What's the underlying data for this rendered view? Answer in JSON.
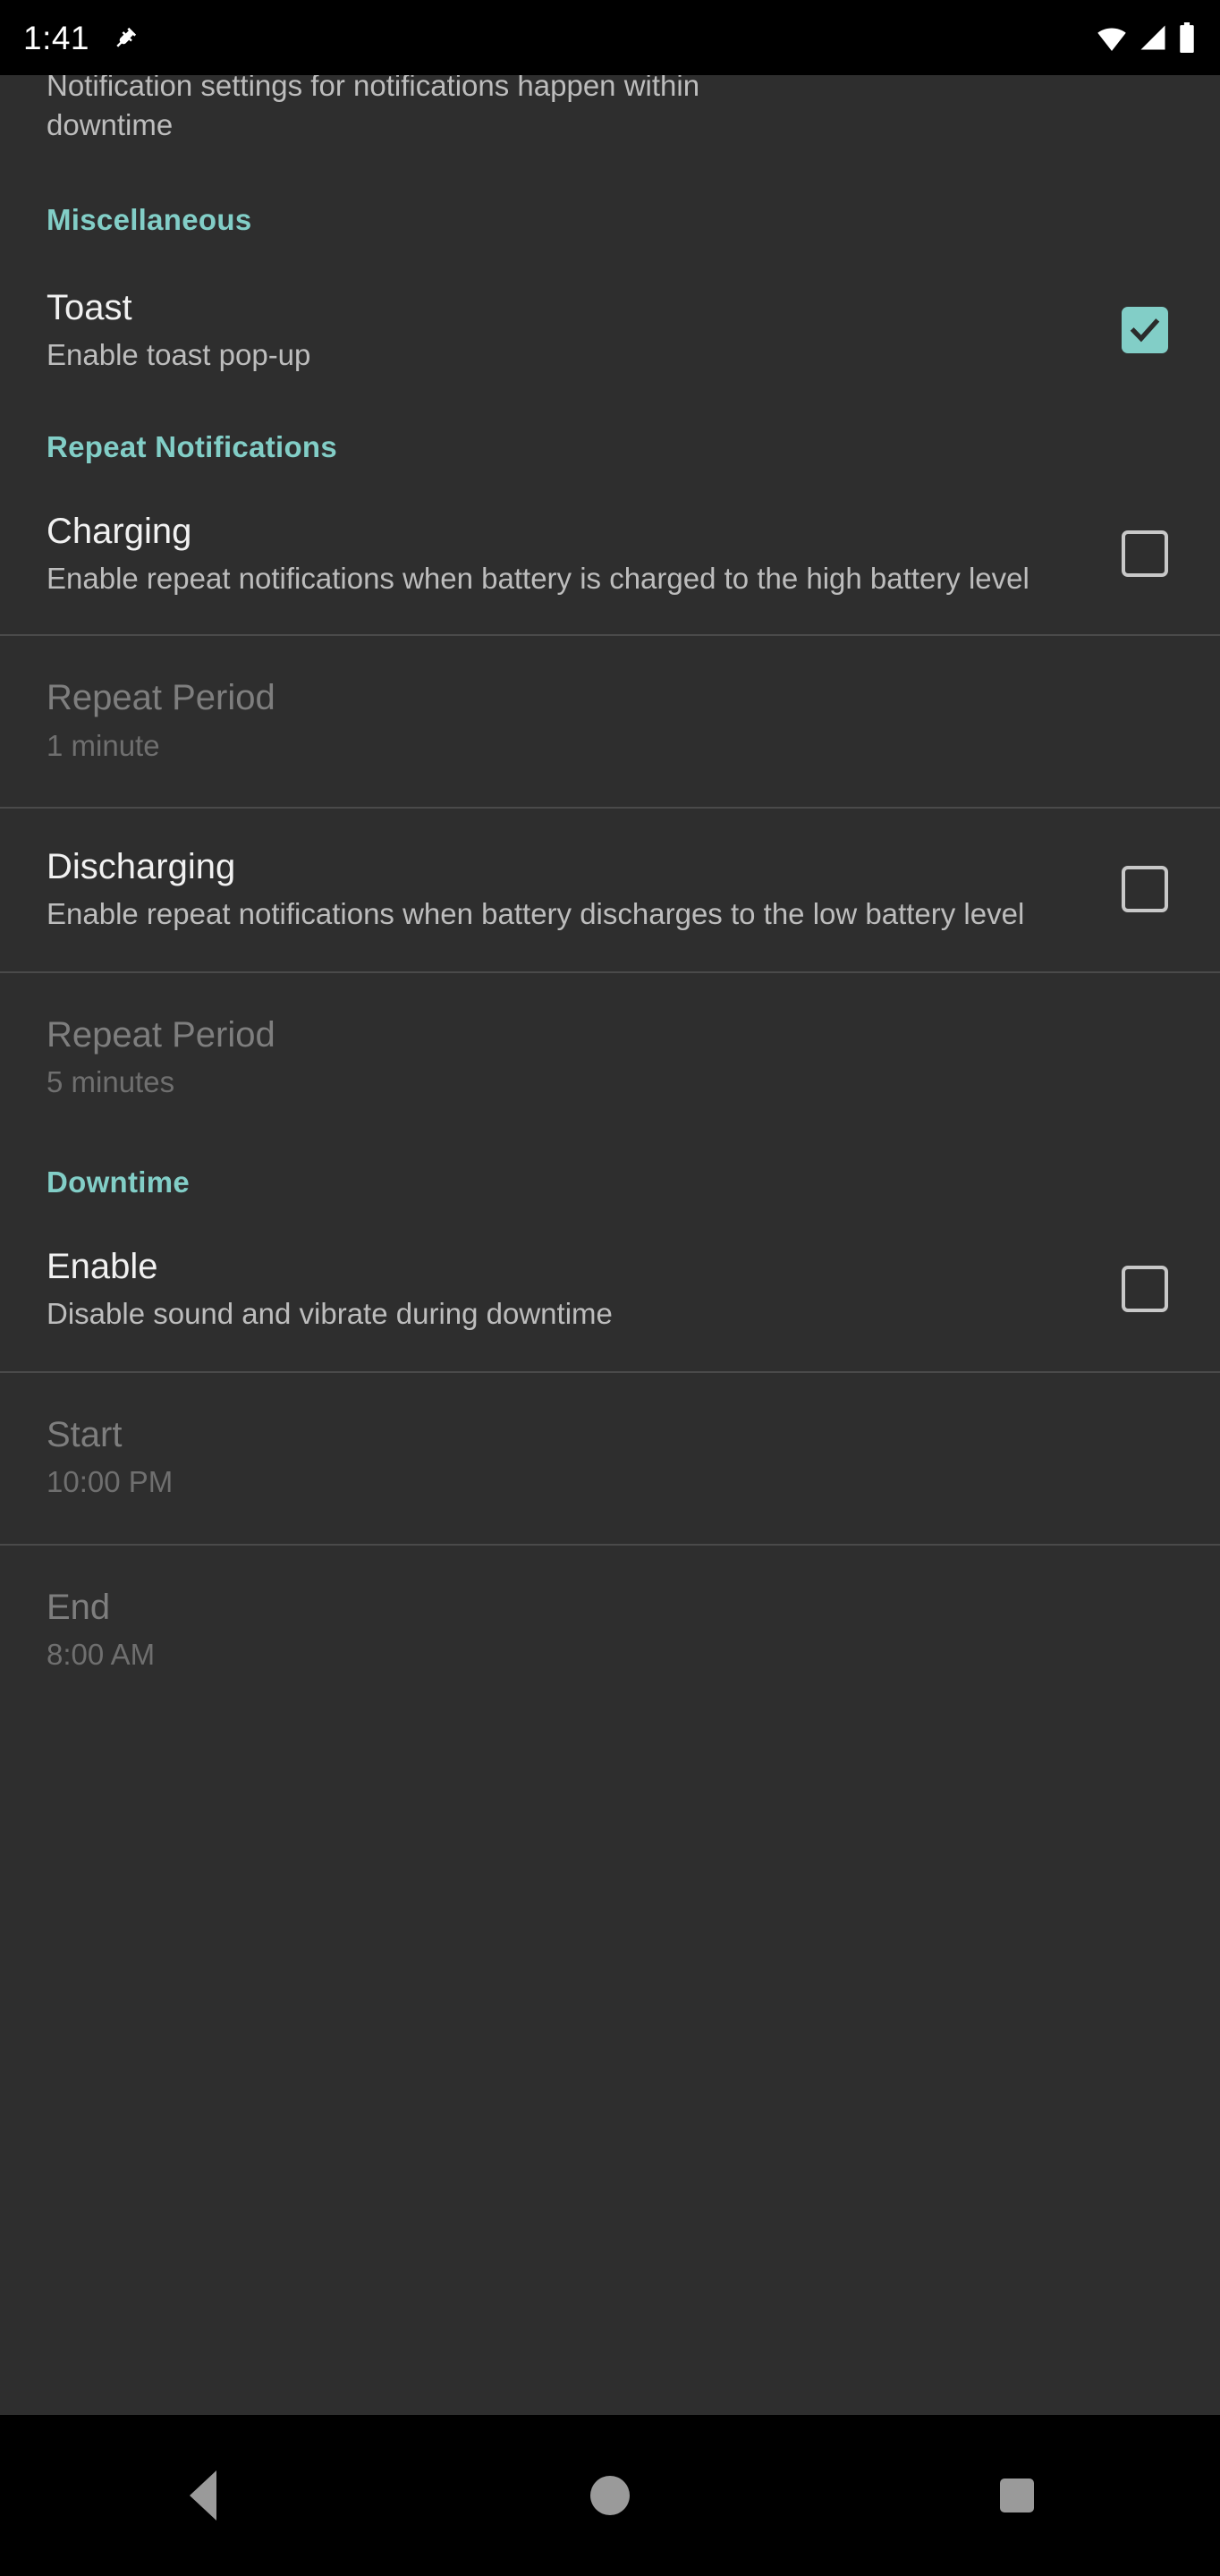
{
  "status_bar": {
    "clock": "1:41",
    "icons": [
      "plug-icon",
      "wifi-icon",
      "cellular-signal-icon",
      "battery-icon"
    ]
  },
  "colors": {
    "background": "#2e2e2e",
    "accent_teal": "#82cec7",
    "title_text": "#f1f1f1",
    "summary_text": "#bdbdbd",
    "disabled_text": "#7e7e7e",
    "divider": "#4a4a4a",
    "status_bar_bg": "#000000"
  },
  "clipped_item": {
    "summary_line1": "Notification settings for notifications happen within",
    "summary_line2": "downtime"
  },
  "sections": [
    {
      "header": "Miscellaneous",
      "items": [
        {
          "title": "Toast",
          "summary": "Enable toast pop-up",
          "checkbox": "checked",
          "enabled": true
        }
      ]
    },
    {
      "header": "Repeat Notifications",
      "items": [
        {
          "title": "Charging",
          "summary": "Enable repeat notifications when battery is charged to the high battery level",
          "checkbox": "unchecked",
          "enabled": true
        },
        {
          "title": "Repeat Period",
          "summary": "1 minute",
          "checkbox": "none",
          "enabled": false
        },
        {
          "title": "Discharging",
          "summary": "Enable repeat notifications when battery discharges to the low battery level",
          "checkbox": "unchecked",
          "enabled": true
        },
        {
          "title": "Repeat Period",
          "summary": "5 minutes",
          "checkbox": "none",
          "enabled": false
        }
      ]
    },
    {
      "header": "Downtime",
      "items": [
        {
          "title": "Enable",
          "summary": "Disable sound and vibrate during downtime",
          "checkbox": "unchecked",
          "enabled": true
        },
        {
          "title": "Start",
          "summary": "10:00 PM",
          "checkbox": "none",
          "enabled": false
        },
        {
          "title": "End",
          "summary": "8:00 AM",
          "checkbox": "none",
          "enabled": false
        }
      ]
    }
  ],
  "nav_bar": {
    "back": "back-icon",
    "home": "home-icon",
    "recents": "recents-icon"
  }
}
